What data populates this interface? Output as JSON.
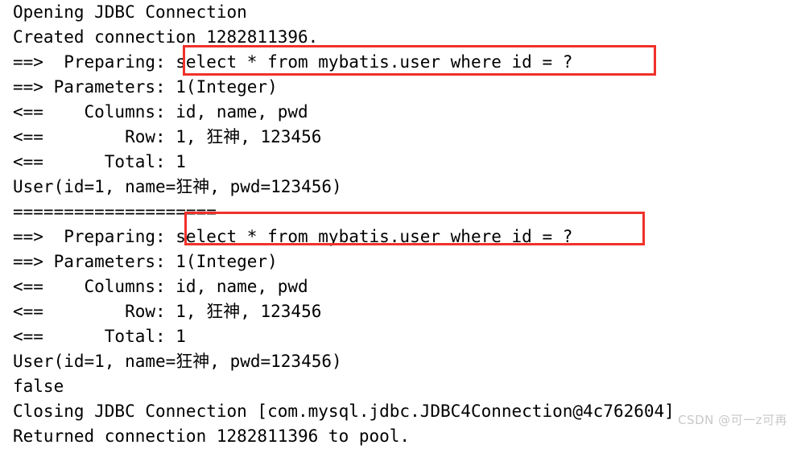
{
  "console": {
    "background_color": "#ffffff",
    "text_color": "#000000",
    "highlight_color": "#f0312a",
    "lines": [
      {
        "text": "Opening JDBC Connection"
      },
      {
        "text": "Created connection 1282811396."
      },
      {
        "text": "==>  Preparing: select * from mybatis.user where id = ?"
      },
      {
        "text": "==> Parameters: 1(Integer)"
      },
      {
        "text": "<==    Columns: id, name, pwd"
      },
      {
        "text": "<==        Row: 1, 狂神, 123456"
      },
      {
        "text": "<==      Total: 1"
      },
      {
        "text": "User(id=1, name=狂神, pwd=123456)"
      },
      {
        "text": "===================="
      },
      {
        "text": "==>  Preparing: select * from mybatis.user where id = ?"
      },
      {
        "text": "==> Parameters: 1(Integer)"
      },
      {
        "text": "<==    Columns: id, name, pwd"
      },
      {
        "text": "<==        Row: 1, 狂神, 123456"
      },
      {
        "text": "<==      Total: 1"
      },
      {
        "text": "User(id=1, name=狂神, pwd=123456)"
      },
      {
        "text": "false"
      },
      {
        "text": "Closing JDBC Connection [com.mysql.jdbc.JDBC4Connection@4c762604]"
      },
      {
        "text": "Returned connection 1282811396 to pool."
      }
    ]
  },
  "highlights": [
    {
      "id": "hl-1",
      "label": "sql-highlight-first",
      "content": "select * from mybatis.user where id = ?"
    },
    {
      "id": "hl-2",
      "label": "sql-highlight-second",
      "content": "select * from mybatis.user where id = ?"
    }
  ],
  "watermark": {
    "text": "CSDN @可一z可再"
  }
}
